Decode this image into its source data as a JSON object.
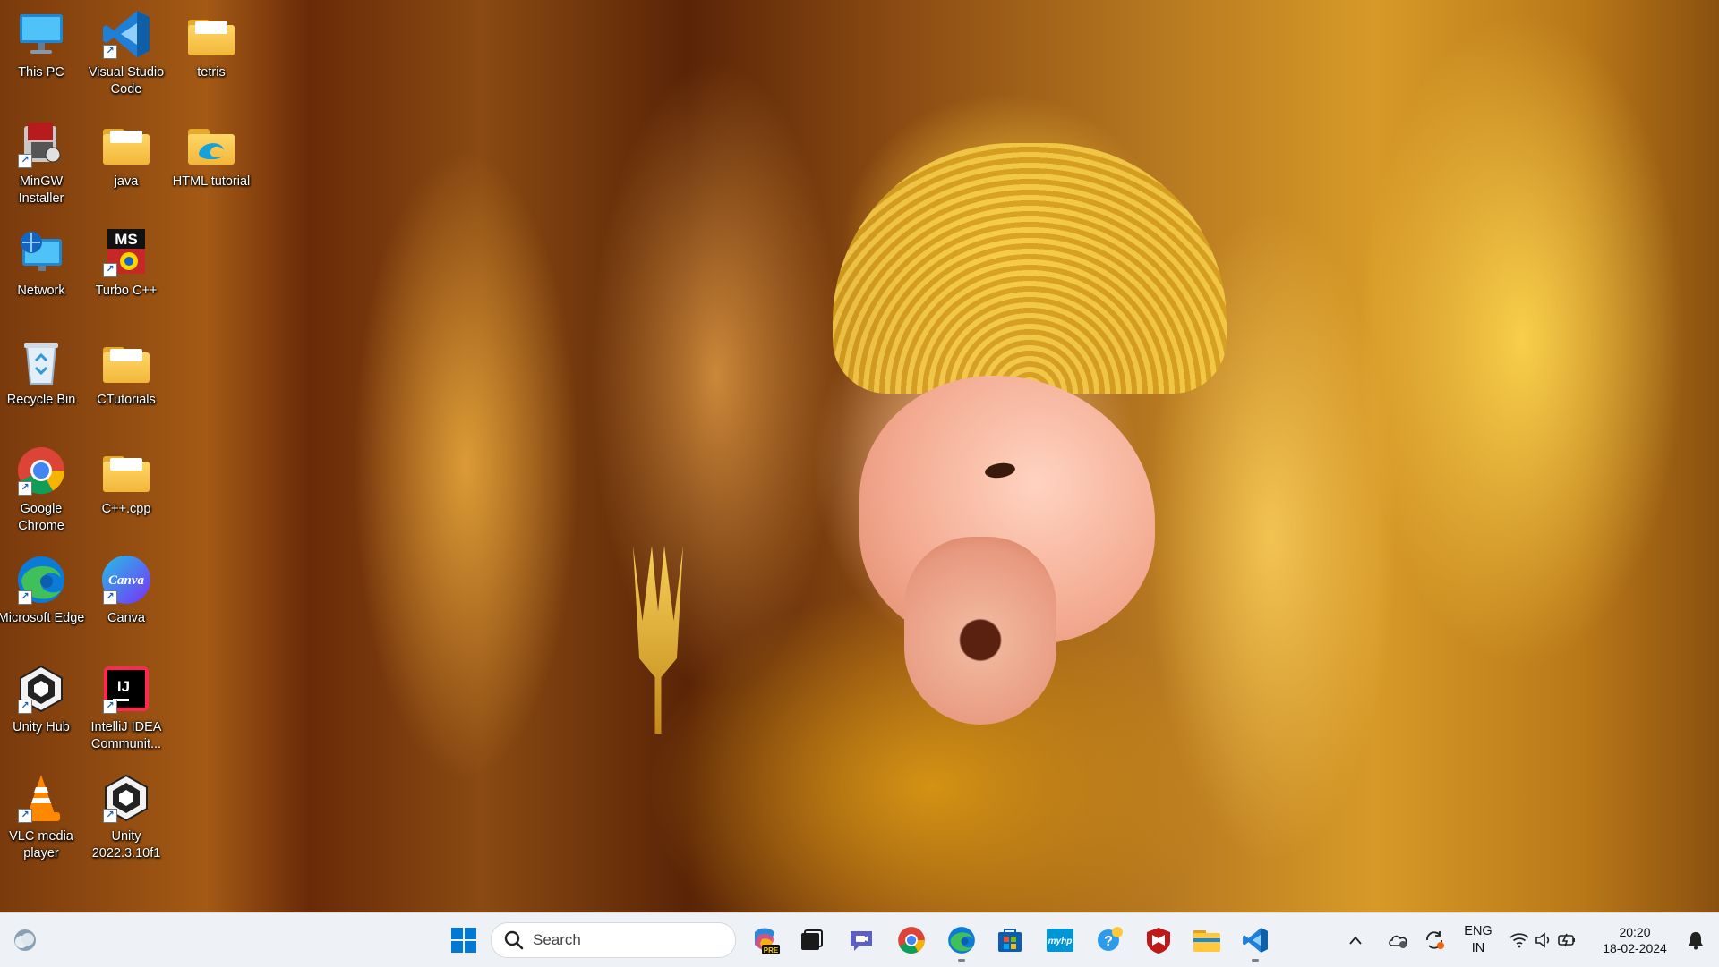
{
  "desktop": {
    "icons": [
      {
        "label": "This PC",
        "icon": "monitor-icon"
      },
      {
        "label": "Visual Studio Code",
        "icon": "vscode-icon"
      },
      {
        "label": "tetris",
        "icon": "folder-icon"
      },
      {
        "label": "MinGW Installer",
        "icon": "mingw-icon"
      },
      {
        "label": "java",
        "icon": "folder-icon"
      },
      {
        "label": "HTML tutorial",
        "icon": "folder-edge-icon"
      },
      {
        "label": "Network",
        "icon": "network-icon"
      },
      {
        "label": "Turbo C++",
        "icon": "turbo-cpp-icon"
      },
      {
        "label": "Recycle Bin",
        "icon": "recycle-bin-icon"
      },
      {
        "label": "CTutorials",
        "icon": "folder-icon"
      },
      {
        "label": "Google Chrome",
        "icon": "chrome-icon"
      },
      {
        "label": "C++.cpp",
        "icon": "folder-icon"
      },
      {
        "label": "Microsoft Edge",
        "icon": "edge-icon"
      },
      {
        "label": "Canva",
        "icon": "canva-icon"
      },
      {
        "label": "Unity Hub",
        "icon": "unity-hub-icon"
      },
      {
        "label": "IntelliJ IDEA Communit...",
        "icon": "intellij-icon"
      },
      {
        "label": "VLC media player",
        "icon": "vlc-icon"
      },
      {
        "label": "Unity 2022.3.10f1",
        "icon": "unity-icon"
      }
    ]
  },
  "taskbar": {
    "search_label": "Search",
    "language_line1": "ENG",
    "language_line2": "IN",
    "time": "20:20",
    "date": "18-02-2024",
    "canva_text": "Canva",
    "turbo_text": "MS",
    "intellij_text": "IJ",
    "copilot_badge": "PRE",
    "myhp_text": "myhp"
  },
  "colors": {
    "taskbar_bg": "#eef1f5",
    "accent_blue": "#0078d4"
  }
}
